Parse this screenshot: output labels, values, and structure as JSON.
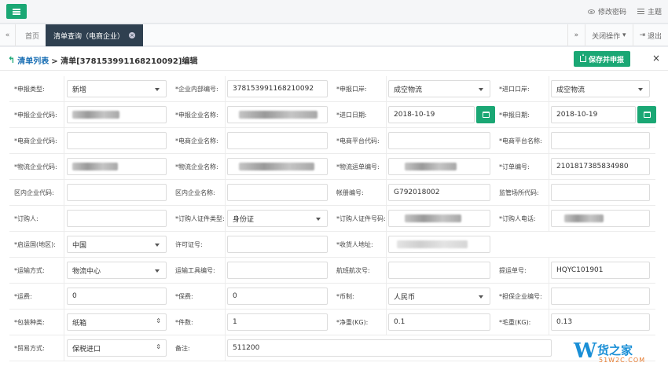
{
  "topbar": {
    "change_password": "修改密码",
    "theme": "主题"
  },
  "tabs": {
    "home": "首页",
    "active": "清单查询（电商企业）",
    "close_ops": "关闭操作",
    "logout": "退出"
  },
  "header": {
    "back_link": "清单列表",
    "title": "> 清单[378153991168210092]编辑",
    "save_button": "保存并申报"
  },
  "form": {
    "r1": {
      "l1": "*申报类型:",
      "v1": "新增",
      "l2": "*企业内部编号:",
      "v2": "378153991168210092",
      "l3": "*申报口岸:",
      "v3": "成空物流",
      "l4": "*进口口岸:",
      "v4": "成空物流"
    },
    "r2": {
      "l1": "*申报企业代码:",
      "l2": "*申报企业名称:",
      "l3": "*进口日期:",
      "v3": "2018-10-19",
      "l4": "*申报日期:",
      "v4": "2018-10-19"
    },
    "r3": {
      "l1": "*电商企业代码:",
      "l2": "*电商企业名称:",
      "l3": "*电商平台代码:",
      "l4": "*电商平台名称:"
    },
    "r4": {
      "l1": "*物流企业代码:",
      "l2": "*物流企业名称:",
      "l3": "*物流运单编号:",
      "l4": "*订单编号:",
      "v4": "2101817385834980"
    },
    "r5": {
      "l1": "区内企业代码:",
      "l2": "区内企业名称:",
      "l3": "帐册编号:",
      "v3": "G792018002",
      "l4": "监管场所代码:"
    },
    "r6": {
      "l1": "*订购人:",
      "l2": "*订购人证件类型:",
      "v2": "身份证",
      "l3": "*订购人证件号码:",
      "l4": "*订购人电话:"
    },
    "r7": {
      "l1": "*启运国(地区):",
      "v1": "中国",
      "l2": "许可证号:",
      "l3": "*收货人地址:"
    },
    "r8": {
      "l1": "*运输方式:",
      "v1": "物流中心",
      "l2": "运输工具编号:",
      "l3": "航班航次号:",
      "l4": "提运单号:",
      "v4": "HQYC101901"
    },
    "r9": {
      "l1": "*运费:",
      "v1": "0",
      "l2": "*保费:",
      "v2": "0",
      "l3": "*币制:",
      "v3": "人民币",
      "l4": "*担保企业编号:"
    },
    "r10": {
      "l1": "*包装种类:",
      "v1": "纸箱",
      "l2": "*件数:",
      "v2": "1",
      "l3": "*净重(KG):",
      "v3": "0.1",
      "l4": "*毛重(KG):",
      "v4": "0.13"
    },
    "r11": {
      "l1": "*贸易方式:",
      "v1": "保税进口",
      "l2": "备注:",
      "v2": "511200"
    }
  },
  "watermark": {
    "logo_text": "货之家",
    "site": "51W2C.COM"
  }
}
